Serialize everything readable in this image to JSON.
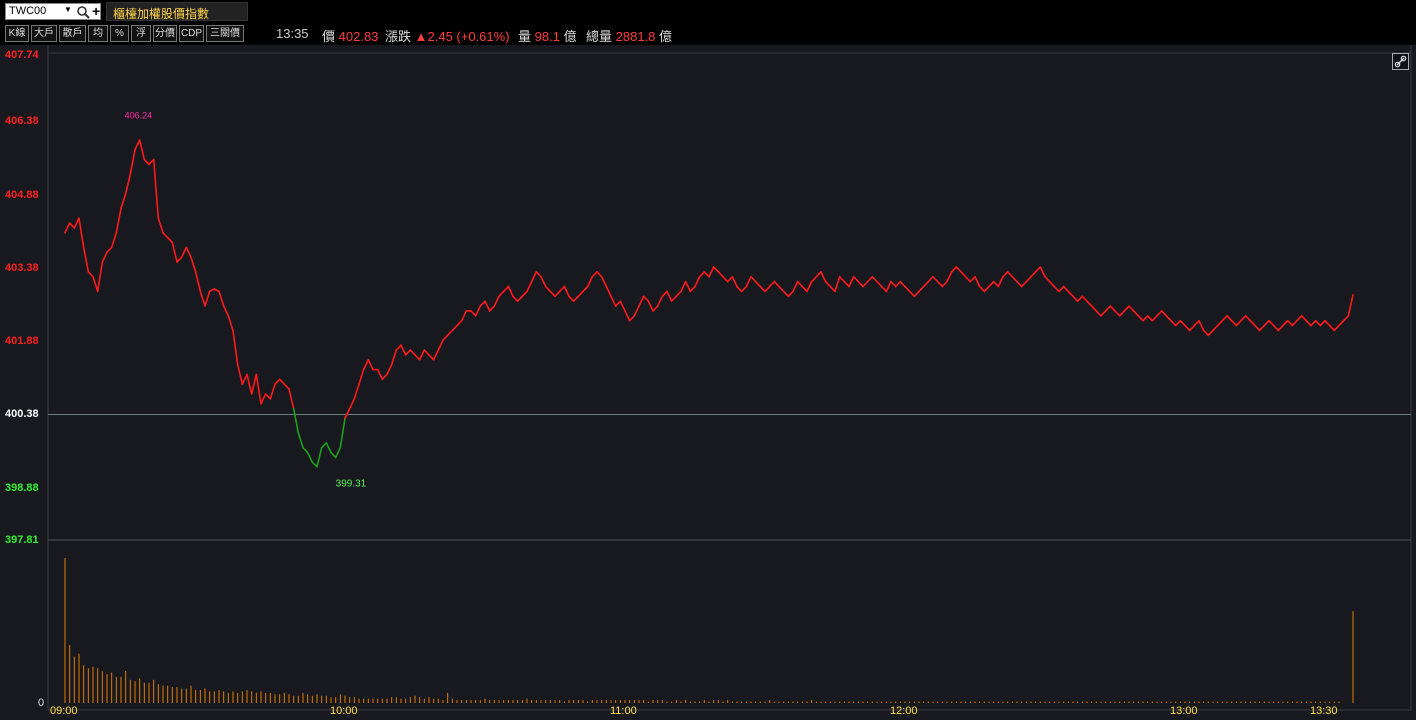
{
  "header": {
    "symbol": "TWC00",
    "title": "櫃檯加權股價指數"
  },
  "toolbar": {
    "buttons": [
      "K線",
      "大戶",
      "散戶",
      "均",
      "%",
      "浮",
      "分價",
      "CDP",
      "三關價"
    ]
  },
  "quote": {
    "time": "13:35",
    "price_label": "價",
    "price": "402.83",
    "change_label": "漲跌",
    "change": "▲2.45 (+0.61%)",
    "volume_label": "量",
    "volume": "98.1",
    "volume_unit": "億",
    "total_label": "總量",
    "total": "2881.8",
    "total_unit": "億"
  },
  "colors": {
    "up": "#ff1a1a",
    "down": "#1aa21a",
    "volume": "#e07b00",
    "axis_time": "#ffe14a",
    "high_label": "#ff2aa3",
    "low_label": "#5df05d"
  },
  "chart_data": {
    "type": "line",
    "y_ticks": [
      {
        "label": "407.74",
        "value": 407.74,
        "color": "#ff2020"
      },
      {
        "label": "406.38",
        "value": 406.38,
        "color": "#ff2020"
      },
      {
        "label": "404.88",
        "value": 404.88,
        "color": "#ff2020"
      },
      {
        "label": "403.38",
        "value": 403.38,
        "color": "#ff2020"
      },
      {
        "label": "401.88",
        "value": 401.88,
        "color": "#ff2020"
      },
      {
        "label": "400.38",
        "value": 400.38,
        "color": "#ffffff"
      },
      {
        "label": "398.88",
        "value": 398.88,
        "color": "#33ee33"
      },
      {
        "label": "397.81",
        "value": 397.81,
        "color": "#33ee33"
      }
    ],
    "ylim": [
      397.81,
      407.74
    ],
    "reference": 400.38,
    "x_ticks": [
      "09:00",
      "10:00",
      "11:00",
      "12:00",
      "13:00",
      "13:30"
    ],
    "x_tick_minutes": [
      0,
      60,
      120,
      180,
      240,
      270
    ],
    "xlim_minutes": [
      0,
      285
    ],
    "high_label": "406.24",
    "high": {
      "minute": 16,
      "value": 406.24
    },
    "low_label": "399.31",
    "low": {
      "minute": 61,
      "value": 399.31
    },
    "volume_ylabel": "0",
    "series": [
      {
        "points": [
          [
            0,
            404.1
          ],
          [
            1,
            404.3
          ],
          [
            2,
            404.2
          ],
          [
            3,
            404.4
          ],
          [
            4,
            403.8
          ],
          [
            5,
            403.3
          ],
          [
            6,
            403.2
          ],
          [
            7,
            402.9
          ],
          [
            8,
            403.5
          ],
          [
            9,
            403.7
          ],
          [
            10,
            403.8
          ],
          [
            11,
            404.1
          ],
          [
            12,
            404.6
          ],
          [
            13,
            404.9
          ],
          [
            14,
            405.3
          ],
          [
            15,
            405.8
          ],
          [
            16,
            406.0
          ],
          [
            17,
            405.6
          ],
          [
            18,
            405.5
          ],
          [
            19,
            405.6
          ],
          [
            20,
            404.4
          ],
          [
            21,
            404.1
          ],
          [
            22,
            404.0
          ],
          [
            23,
            403.9
          ],
          [
            24,
            403.5
          ],
          [
            25,
            403.6
          ],
          [
            26,
            403.8
          ],
          [
            27,
            403.6
          ],
          [
            28,
            403.3
          ],
          [
            29,
            402.9
          ],
          [
            30,
            402.6
          ],
          [
            31,
            402.9
          ],
          [
            32,
            402.95
          ],
          [
            33,
            402.9
          ],
          [
            34,
            402.6
          ],
          [
            35,
            402.4
          ],
          [
            36,
            402.1
          ],
          [
            37,
            401.4
          ],
          [
            38,
            401.0
          ],
          [
            39,
            401.2
          ],
          [
            40,
            400.8
          ],
          [
            41,
            401.2
          ],
          [
            42,
            400.6
          ],
          [
            43,
            400.8
          ],
          [
            44,
            400.7
          ],
          [
            45,
            401.0
          ],
          [
            46,
            401.1
          ],
          [
            47,
            401.0
          ],
          [
            48,
            400.9
          ],
          [
            49,
            400.5
          ],
          [
            50,
            400.0
          ],
          [
            51,
            399.7
          ],
          [
            52,
            399.6
          ],
          [
            53,
            399.4
          ],
          [
            54,
            399.31
          ],
          [
            55,
            399.7
          ],
          [
            56,
            399.8
          ],
          [
            57,
            399.6
          ],
          [
            58,
            399.5
          ],
          [
            59,
            399.7
          ],
          [
            60,
            400.3
          ],
          [
            61,
            400.5
          ],
          [
            62,
            400.7
          ],
          [
            63,
            401.0
          ],
          [
            64,
            401.3
          ],
          [
            65,
            401.5
          ],
          [
            66,
            401.3
          ],
          [
            67,
            401.3
          ],
          [
            68,
            401.1
          ],
          [
            69,
            401.2
          ],
          [
            70,
            401.4
          ],
          [
            71,
            401.7
          ],
          [
            72,
            401.8
          ],
          [
            73,
            401.6
          ],
          [
            74,
            401.7
          ],
          [
            75,
            401.6
          ],
          [
            76,
            401.5
          ],
          [
            77,
            401.7
          ],
          [
            78,
            401.6
          ],
          [
            79,
            401.5
          ],
          [
            80,
            401.7
          ],
          [
            81,
            401.9
          ],
          [
            82,
            402.0
          ],
          [
            83,
            402.1
          ],
          [
            84,
            402.2
          ],
          [
            85,
            402.3
          ],
          [
            86,
            402.5
          ],
          [
            87,
            402.5
          ],
          [
            88,
            402.4
          ],
          [
            89,
            402.6
          ],
          [
            90,
            402.7
          ],
          [
            91,
            402.5
          ],
          [
            92,
            402.6
          ],
          [
            93,
            402.8
          ],
          [
            94,
            402.9
          ],
          [
            95,
            403.0
          ],
          [
            96,
            402.8
          ],
          [
            97,
            402.7
          ],
          [
            98,
            402.8
          ],
          [
            99,
            402.9
          ],
          [
            100,
            403.1
          ],
          [
            101,
            403.3
          ],
          [
            102,
            403.2
          ],
          [
            103,
            403.0
          ],
          [
            104,
            402.9
          ],
          [
            105,
            402.8
          ],
          [
            106,
            402.9
          ],
          [
            107,
            403.0
          ],
          [
            108,
            402.8
          ],
          [
            109,
            402.7
          ],
          [
            110,
            402.8
          ],
          [
            111,
            402.9
          ],
          [
            112,
            403.0
          ],
          [
            113,
            403.2
          ],
          [
            114,
            403.3
          ],
          [
            115,
            403.2
          ],
          [
            116,
            403.0
          ],
          [
            117,
            402.8
          ],
          [
            118,
            402.6
          ],
          [
            119,
            402.7
          ],
          [
            120,
            402.5
          ],
          [
            121,
            402.3
          ],
          [
            122,
            402.4
          ],
          [
            123,
            402.6
          ],
          [
            124,
            402.8
          ],
          [
            125,
            402.7
          ],
          [
            126,
            402.5
          ],
          [
            127,
            402.6
          ],
          [
            128,
            402.8
          ],
          [
            129,
            402.9
          ],
          [
            130,
            402.7
          ],
          [
            131,
            402.8
          ],
          [
            132,
            402.9
          ],
          [
            133,
            403.1
          ],
          [
            134,
            402.9
          ],
          [
            135,
            403.0
          ],
          [
            136,
            403.2
          ],
          [
            137,
            403.3
          ],
          [
            138,
            403.2
          ],
          [
            139,
            403.4
          ],
          [
            140,
            403.3
          ],
          [
            141,
            403.2
          ],
          [
            142,
            403.1
          ],
          [
            143,
            403.2
          ],
          [
            144,
            403.0
          ],
          [
            145,
            402.9
          ],
          [
            146,
            403.0
          ],
          [
            147,
            403.2
          ],
          [
            148,
            403.1
          ],
          [
            149,
            403.0
          ],
          [
            150,
            402.9
          ],
          [
            151,
            403.0
          ],
          [
            152,
            403.1
          ],
          [
            153,
            403.0
          ],
          [
            154,
            402.9
          ],
          [
            155,
            402.8
          ],
          [
            156,
            402.9
          ],
          [
            157,
            403.1
          ],
          [
            158,
            403.0
          ],
          [
            159,
            402.9
          ],
          [
            160,
            403.1
          ],
          [
            161,
            403.2
          ],
          [
            162,
            403.3
          ],
          [
            163,
            403.1
          ],
          [
            164,
            403.0
          ],
          [
            165,
            402.9
          ],
          [
            166,
            403.2
          ],
          [
            167,
            403.1
          ],
          [
            168,
            403.0
          ],
          [
            169,
            403.2
          ],
          [
            170,
            403.1
          ],
          [
            171,
            403.0
          ],
          [
            172,
            403.1
          ],
          [
            173,
            403.2
          ],
          [
            174,
            403.1
          ],
          [
            175,
            403.0
          ],
          [
            176,
            402.9
          ],
          [
            177,
            403.1
          ],
          [
            178,
            403.0
          ],
          [
            179,
            403.1
          ],
          [
            180,
            403.0
          ],
          [
            181,
            402.9
          ],
          [
            182,
            402.8
          ],
          [
            183,
            402.9
          ],
          [
            184,
            403.0
          ],
          [
            185,
            403.1
          ],
          [
            186,
            403.2
          ],
          [
            187,
            403.1
          ],
          [
            188,
            403.0
          ],
          [
            189,
            403.1
          ],
          [
            190,
            403.3
          ],
          [
            191,
            403.4
          ],
          [
            192,
            403.3
          ],
          [
            193,
            403.2
          ],
          [
            194,
            403.1
          ],
          [
            195,
            403.2
          ],
          [
            196,
            403.0
          ],
          [
            197,
            402.9
          ],
          [
            198,
            403.0
          ],
          [
            199,
            403.1
          ],
          [
            200,
            403.0
          ],
          [
            201,
            403.2
          ],
          [
            202,
            403.3
          ],
          [
            203,
            403.2
          ],
          [
            204,
            403.1
          ],
          [
            205,
            403.0
          ],
          [
            206,
            403.1
          ],
          [
            207,
            403.2
          ],
          [
            208,
            403.3
          ],
          [
            209,
            403.4
          ],
          [
            210,
            403.2
          ],
          [
            211,
            403.1
          ],
          [
            212,
            403.0
          ],
          [
            213,
            402.9
          ],
          [
            214,
            403.0
          ],
          [
            215,
            402.9
          ],
          [
            216,
            402.8
          ],
          [
            217,
            402.7
          ],
          [
            218,
            402.8
          ],
          [
            219,
            402.7
          ],
          [
            220,
            402.6
          ],
          [
            221,
            402.5
          ],
          [
            222,
            402.4
          ],
          [
            223,
            402.5
          ],
          [
            224,
            402.6
          ],
          [
            225,
            402.5
          ],
          [
            226,
            402.4
          ],
          [
            227,
            402.5
          ],
          [
            228,
            402.6
          ],
          [
            229,
            402.5
          ],
          [
            230,
            402.4
          ],
          [
            231,
            402.3
          ],
          [
            232,
            402.4
          ],
          [
            233,
            402.3
          ],
          [
            234,
            402.4
          ],
          [
            235,
            402.5
          ],
          [
            236,
            402.4
          ],
          [
            237,
            402.3
          ],
          [
            238,
            402.2
          ],
          [
            239,
            402.3
          ],
          [
            240,
            402.2
          ],
          [
            241,
            402.1
          ],
          [
            242,
            402.2
          ],
          [
            243,
            402.3
          ],
          [
            244,
            402.1
          ],
          [
            245,
            402.0
          ],
          [
            246,
            402.1
          ],
          [
            247,
            402.2
          ],
          [
            248,
            402.3
          ],
          [
            249,
            402.4
          ],
          [
            250,
            402.3
          ],
          [
            251,
            402.2
          ],
          [
            252,
            402.3
          ],
          [
            253,
            402.4
          ],
          [
            254,
            402.3
          ],
          [
            255,
            402.2
          ],
          [
            256,
            402.1
          ],
          [
            257,
            402.2
          ],
          [
            258,
            402.3
          ],
          [
            259,
            402.2
          ],
          [
            260,
            402.1
          ],
          [
            261,
            402.2
          ],
          [
            262,
            402.3
          ],
          [
            263,
            402.2
          ],
          [
            264,
            402.3
          ],
          [
            265,
            402.4
          ],
          [
            266,
            402.3
          ],
          [
            267,
            402.2
          ],
          [
            268,
            402.3
          ],
          [
            269,
            402.2
          ],
          [
            270,
            402.3
          ],
          [
            271,
            402.2
          ],
          [
            272,
            402.1
          ],
          [
            273,
            402.2
          ],
          [
            274,
            402.3
          ],
          [
            275,
            402.4
          ],
          [
            276,
            402.83
          ]
        ]
      }
    ]
  }
}
